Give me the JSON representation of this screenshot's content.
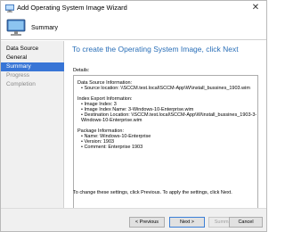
{
  "window": {
    "title": "Add Operating System Image Wizard",
    "close_glyph": "✕"
  },
  "header": {
    "title": "Summary"
  },
  "sidebar": {
    "items": [
      {
        "label": "Data Source",
        "state": "normal"
      },
      {
        "label": "General",
        "state": "normal"
      },
      {
        "label": "Summary",
        "state": "active"
      },
      {
        "label": "Progress",
        "state": "dim"
      },
      {
        "label": "Completion",
        "state": "dim"
      }
    ]
  },
  "main": {
    "heading": "To create the Operating System Image, click Next",
    "details_label": "Details:",
    "details": {
      "data_source_header": "Data Source Information:",
      "source_location": "• Source location: \\\\SCCM.test.local\\SCCM-App\\W\\install_bussines_1903.wim",
      "index_header": "Index Export Information:",
      "image_index": "• Image Index: 3",
      "image_index_name": "• Image Index Name: 3-Windows-10-Enterprise.wim",
      "destination_1": "• Destination Location: \\\\SCCM.test.local\\SCCM-App\\W\\install_bussines_1903-3-",
      "destination_2": "  Windows-10-Enterprise.wim",
      "package_header": "Package Information:",
      "name": "• Name: Windows-10-Enterprise",
      "version": "• Version: 1903",
      "comment": "• Comment: Enterprise 1903"
    },
    "footer_note": "To change these settings, click Previous. To apply the settings, click Next."
  },
  "buttons": {
    "previous": "< Previous",
    "next": "Next >",
    "summary": "Summary",
    "cancel": "Cancel"
  },
  "colors": {
    "accent": "#3875d6",
    "heading": "#2a6fb8"
  }
}
